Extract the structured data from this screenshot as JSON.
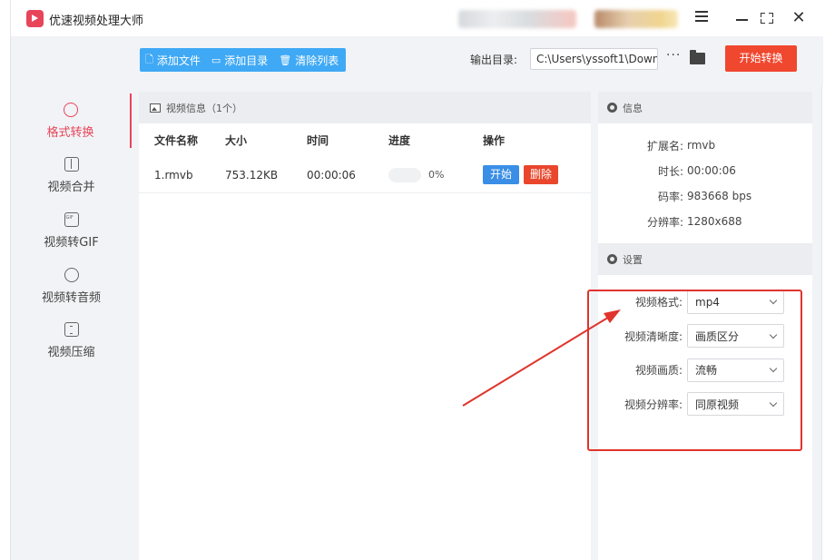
{
  "app": {
    "title": "优速视频处理大师"
  },
  "toolbar": {
    "add_file": "添加文件",
    "add_dir": "添加目录",
    "clear_list": "清除列表",
    "output_label": "输出目录:",
    "output_path": "C:\\Users\\yssoft1\\Down",
    "more": "···",
    "start": "开始转换"
  },
  "sidebar": {
    "items": [
      {
        "label": "格式转换",
        "icon": "format-convert-icon",
        "active": true
      },
      {
        "label": "视频合并",
        "icon": "merge-icon"
      },
      {
        "label": "视频转GIF",
        "icon": "gif-icon"
      },
      {
        "label": "视频转音频",
        "icon": "audio-icon"
      },
      {
        "label": "视频压缩",
        "icon": "compress-icon"
      }
    ]
  },
  "video_panel": {
    "title": "视频信息（1个）",
    "columns": [
      "文件名称",
      "大小",
      "时间",
      "进度",
      "操作"
    ],
    "rows": [
      {
        "name": "1.rmvb",
        "size": "753.12KB",
        "time": "00:00:06",
        "progress": 0,
        "progress_text": "0%",
        "start": "开始",
        "delete": "删除"
      }
    ]
  },
  "info_panel": {
    "title": "信息",
    "ext_label": "扩展名:",
    "ext": "rmvb",
    "duration_label": "时长:",
    "duration": "00:00:06",
    "bitrate_label": "码率:",
    "bitrate": "983668 bps",
    "resolution_label": "分辨率:",
    "resolution": "1280x688"
  },
  "settings_panel": {
    "title": "设置",
    "format_label": "视频格式:",
    "format": "mp4",
    "quality_label": "视频清晰度:",
    "quality": "画质区分",
    "picture_label": "视频画质:",
    "picture": "流畅",
    "resolution_label": "视频分辨率:",
    "resolution": "同原视频"
  },
  "colors": {
    "accent": "#e8455a",
    "primary_blue": "#3fa9f5",
    "start_red": "#f0472f",
    "annotation_red": "#e0342c"
  }
}
